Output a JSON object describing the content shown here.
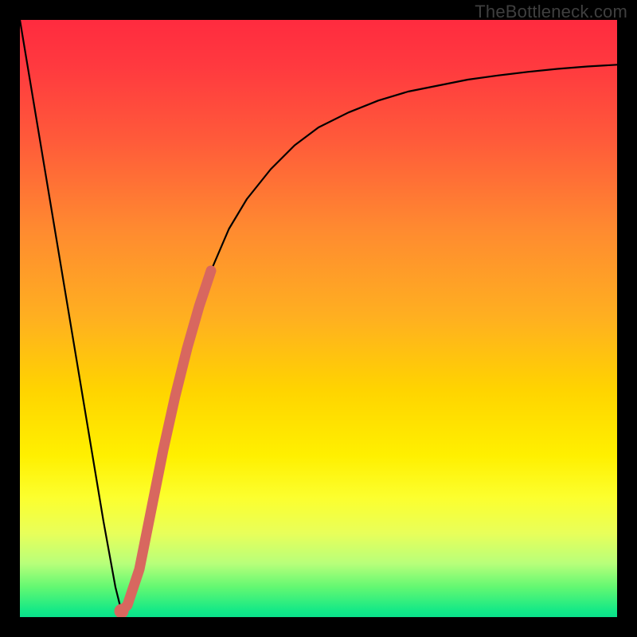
{
  "watermark": "TheBottleneck.com",
  "colors": {
    "frame": "#000000",
    "curve_stroke": "#000000",
    "highlight_stroke": "#d8675f"
  },
  "chart_data": {
    "type": "line",
    "title": "",
    "xlabel": "",
    "ylabel": "",
    "xlim": [
      0,
      100
    ],
    "ylim": [
      0,
      100
    ],
    "grid": false,
    "series": [
      {
        "name": "bottleneck-curve",
        "x": [
          0,
          2,
          4,
          6,
          8,
          10,
          12,
          14,
          16,
          17,
          18,
          20,
          22,
          24,
          26,
          28,
          30,
          32,
          35,
          38,
          42,
          46,
          50,
          55,
          60,
          65,
          70,
          75,
          80,
          85,
          90,
          95,
          100
        ],
        "values": [
          100,
          88,
          76,
          64,
          52,
          40,
          28,
          16,
          5,
          1,
          2,
          8,
          18,
          28,
          37,
          45,
          52,
          58,
          65,
          70,
          75,
          79,
          82,
          84.5,
          86.5,
          88,
          89,
          90,
          90.7,
          91.3,
          91.8,
          92.2,
          92.5
        ]
      },
      {
        "name": "highlight-segment",
        "x": [
          17,
          18,
          20,
          22,
          24,
          26,
          28,
          30,
          32
        ],
        "values": [
          1,
          2,
          8,
          18,
          28,
          37,
          45,
          52,
          58
        ]
      }
    ],
    "annotations": []
  }
}
